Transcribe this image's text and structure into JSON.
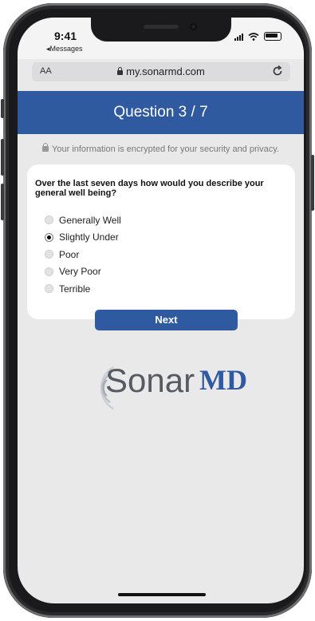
{
  "status_bar": {
    "time": "9:41",
    "back_label": "◂Messages"
  },
  "browser": {
    "text_size_label": "AA",
    "url": "my.sonarmd.com"
  },
  "header": {
    "title": "Question 3 / 7"
  },
  "privacy_notice": "Your information is encrypted for your security and privacy.",
  "survey": {
    "question": "Over the last seven days how would you describe your general well being?",
    "options": [
      {
        "label": "Generally Well",
        "selected": false
      },
      {
        "label": "Slightly Under",
        "selected": true
      },
      {
        "label": "Poor",
        "selected": false
      },
      {
        "label": "Very Poor",
        "selected": false
      },
      {
        "label": "Terrible",
        "selected": false
      }
    ],
    "next_label": "Next"
  },
  "brand": {
    "logo_text": "SonarMD",
    "logo_part1": "Sonar",
    "logo_part2": "MD",
    "accent_color": "#2f5aa0"
  }
}
